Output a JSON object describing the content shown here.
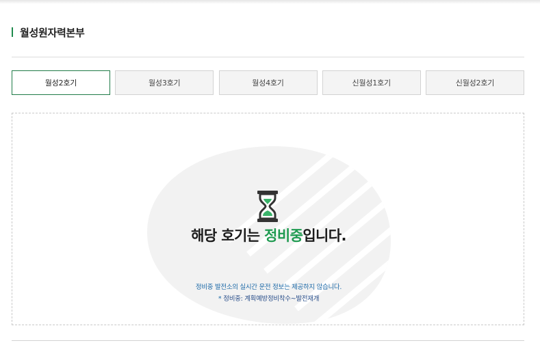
{
  "page": {
    "title": "월성원자력본부"
  },
  "tabs": [
    {
      "label": "월성2호기",
      "active": true
    },
    {
      "label": "월성3호기",
      "active": false
    },
    {
      "label": "월성4호기",
      "active": false
    },
    {
      "label": "신월성1호기",
      "active": false
    },
    {
      "label": "신월성2호기",
      "active": false
    }
  ],
  "status": {
    "headline_prefix": "해당 호기는 ",
    "headline_highlight": "정비중",
    "headline_suffix": "입니다.",
    "note_1": "정비중 발전소의 실시간 운전 정보는 제공하지 않습니다.",
    "note_2_star": "*",
    "note_2": "정비중: 계획예방정비착수~발전재개",
    "icon": "hourglass-icon"
  },
  "colors": {
    "accent": "#1e9a50",
    "tab_active_border": "#1e7a46",
    "note_blue": "#1e6aa8"
  }
}
